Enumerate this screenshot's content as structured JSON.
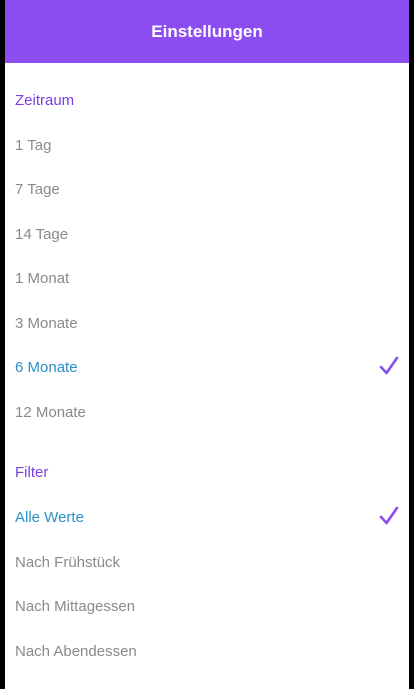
{
  "header": {
    "title": "Einstellungen"
  },
  "zeitraum": {
    "title": "Zeitraum",
    "items": [
      {
        "label": "1 Tag",
        "selected": false
      },
      {
        "label": "7 Tage",
        "selected": false
      },
      {
        "label": "14 Tage",
        "selected": false
      },
      {
        "label": "1 Monat",
        "selected": false
      },
      {
        "label": "3 Monate",
        "selected": false
      },
      {
        "label": "6 Monate",
        "selected": true
      },
      {
        "label": "12 Monate",
        "selected": false
      }
    ]
  },
  "filter": {
    "title": "Filter",
    "items": [
      {
        "label": "Alle Werte",
        "selected": true
      },
      {
        "label": "Nach Frühstück",
        "selected": false
      },
      {
        "label": "Nach Mittagessen",
        "selected": false
      },
      {
        "label": "Nach Abendessen",
        "selected": false
      }
    ]
  },
  "colors": {
    "header": "#8b4cf0",
    "section_title": "#7a3fe4",
    "selected_text": "#2a8fc7",
    "unselected_text": "#8a8a8a",
    "checkmark": "#8b4cf0"
  },
  "icons": {
    "selected_marker": "checkmark-icon"
  }
}
